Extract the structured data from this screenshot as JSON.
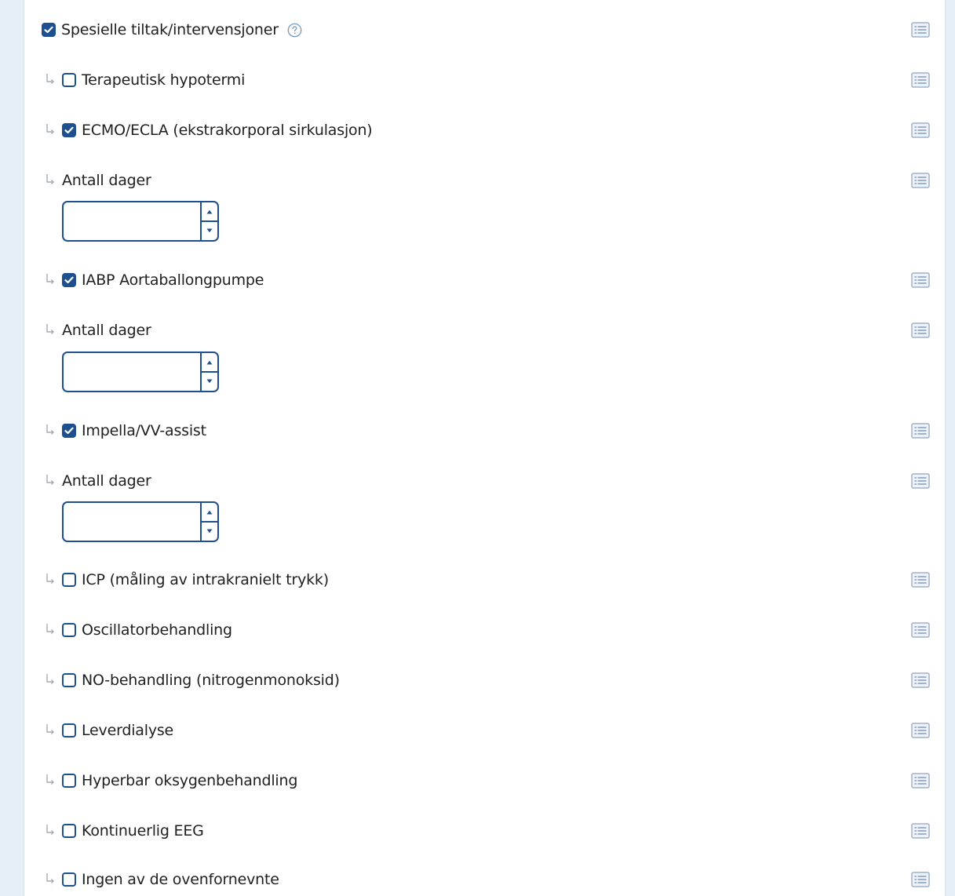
{
  "section": {
    "label": "Spesielle tiltak/intervensjoner",
    "checked": true
  },
  "items": [
    {
      "label": "Terapeutisk hypotermi",
      "checked": false
    },
    {
      "label": "ECMO/ECLA (ekstrakorporal sirkulasjon)",
      "checked": true,
      "days_label": "Antall dager",
      "days_value": ""
    },
    {
      "label": "IABP Aortaballongpumpe",
      "checked": true,
      "days_label": "Antall dager",
      "days_value": ""
    },
    {
      "label": "Impella/VV-assist",
      "checked": true,
      "days_label": "Antall dager",
      "days_value": ""
    },
    {
      "label": "ICP (måling av intrakranielt trykk)",
      "checked": false
    },
    {
      "label": "Oscillatorbehandling",
      "checked": false
    },
    {
      "label": "NO-behandling (nitrogenmonoksid)",
      "checked": false
    },
    {
      "label": "Leverdialyse",
      "checked": false
    },
    {
      "label": "Hyperbar oksygenbehandling",
      "checked": false
    },
    {
      "label": "Kontinuerlig EEG",
      "checked": false
    },
    {
      "label": "Ingen av de ovenfornevnte",
      "checked": false
    }
  ],
  "icons": {
    "help": "help-circle-icon",
    "details": "list-details-icon",
    "sub": "sub-item-arrow-icon"
  },
  "colors": {
    "accent": "#1e4f8f",
    "icon": "#9fb2c9",
    "background": "#e6eef7"
  }
}
